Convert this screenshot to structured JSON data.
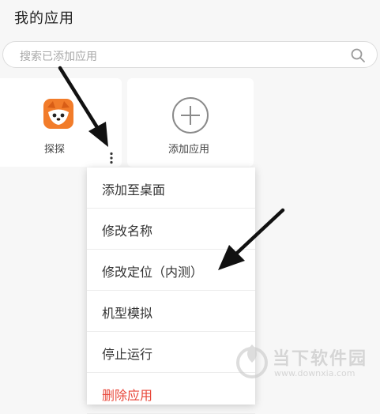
{
  "page": {
    "title": "我的应用"
  },
  "search": {
    "placeholder": "搜索已添加应用"
  },
  "apps": [
    {
      "label": "探探",
      "icon": "fox-icon"
    },
    {
      "label": "添加应用",
      "icon": "plus-circle-icon"
    }
  ],
  "menu": {
    "items": [
      {
        "label": "添加至桌面"
      },
      {
        "label": "修改名称"
      },
      {
        "label": "修改定位（内测）"
      },
      {
        "label": "机型模拟"
      },
      {
        "label": "停止运行"
      },
      {
        "label": "删除应用"
      }
    ]
  },
  "watermark": {
    "name": "当下软件园",
    "url": "www.downxia.com"
  },
  "colors": {
    "background": "#f7f7f7",
    "card": "#ffffff",
    "danger": "#e8473a",
    "fox_orange": "#f27c2a"
  }
}
